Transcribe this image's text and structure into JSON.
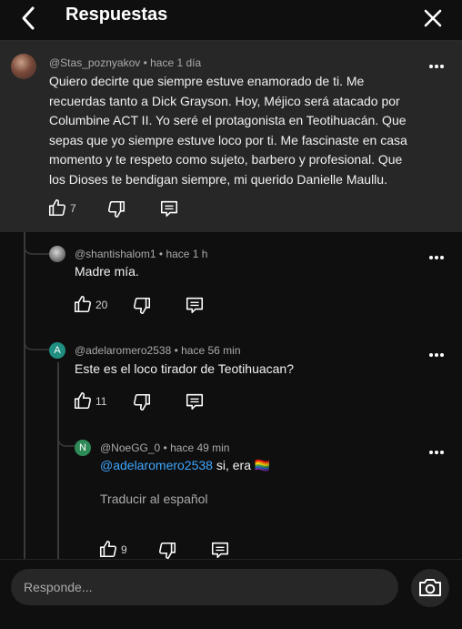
{
  "header": {
    "title": "Respuestas"
  },
  "top_comment": {
    "author": "@Stas_poznyakov",
    "time": "hace 1 día",
    "lines": [
      "Quiero decirte que siempre estuve enamorado de ti. Me",
      "recuerdas tanto a Dick Grayson. Hoy, Méjico será atacado por",
      "Columbine ACT II. Yo seré el protagonista en Teotihuacán. Que",
      "sepas que yo siempre estuve loco por ti. Me fascinaste en casa",
      "momento y te respeto como sujeto, barbero y profesional. Que",
      "los Dioses te bendigan siempre, mi querido Danielle Maullu."
    ],
    "likes": "7"
  },
  "replies": [
    {
      "author": "@shantishalom1",
      "time": "hace 1 h",
      "text": "Madre mía.",
      "likes": "20"
    },
    {
      "author": "@adelaromero2538",
      "time": "hace 56 min",
      "text": "Este es el loco tirador de Teotihuacan?",
      "likes": "11",
      "avatar_letter": "A",
      "avatar_color": "#1e8f80"
    }
  ],
  "nested_reply": {
    "author": "@NoeGG_0",
    "time": "hace 49 min",
    "mention": "@adelaromero2538",
    "text": " si, era ",
    "emoji": "🏳️‍🌈",
    "translate": "Traducir al español",
    "likes": "9",
    "avatar_letter": "N",
    "avatar_color": "#2e8b57"
  },
  "footer": {
    "placeholder": "Responde..."
  },
  "meta_separator": " • "
}
